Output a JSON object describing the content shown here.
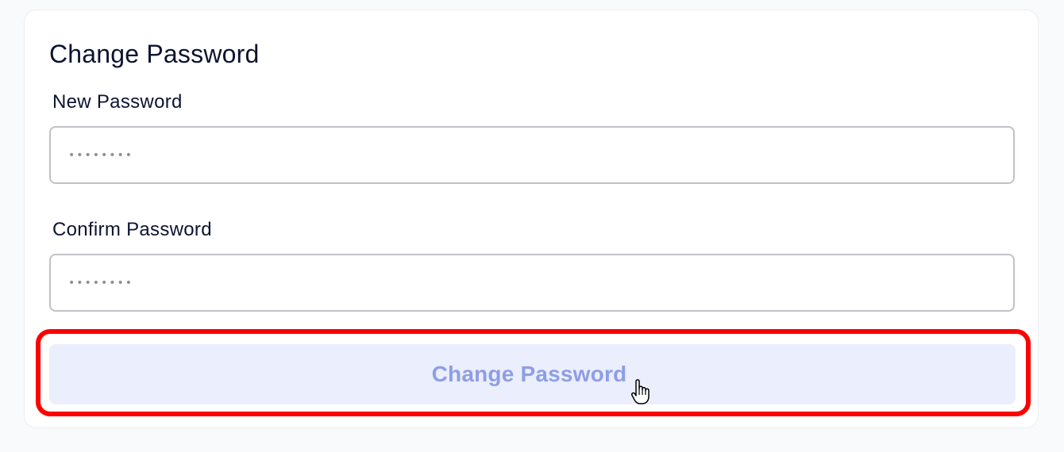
{
  "card": {
    "title": "Change Password"
  },
  "form": {
    "new_password": {
      "label": "New Password",
      "masked_value": "••••••••"
    },
    "confirm_password": {
      "label": "Confirm Password",
      "masked_value": "••••••••"
    },
    "submit_label": "Change Password"
  },
  "icons": {
    "cursor": "hand-pointer-icon"
  },
  "colors": {
    "page_background": "#f9fafc",
    "title_text": "#0c1430",
    "input_border": "#bfc2c8",
    "button_background": "#ebeefc",
    "button_text": "#8e9ee5",
    "highlight": "#ff0000"
  }
}
